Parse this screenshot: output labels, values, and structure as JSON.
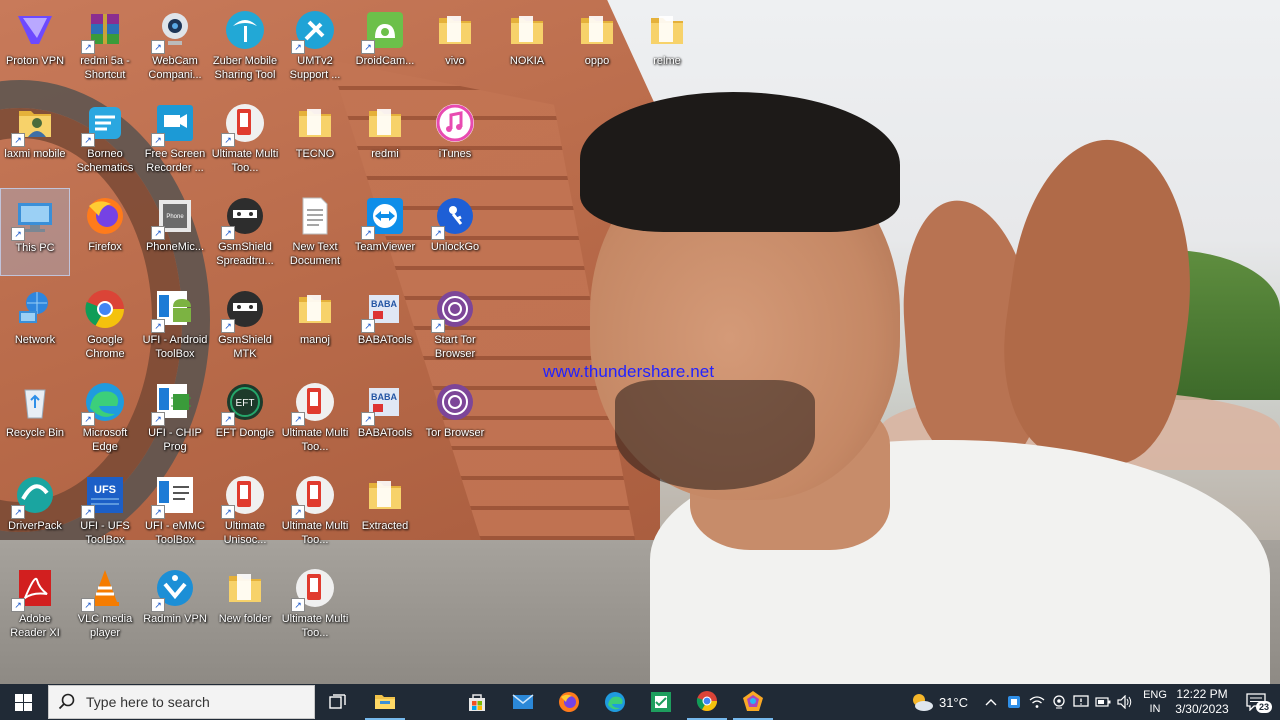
{
  "desktop": {
    "watermark": "www.thundershare.net",
    "icons": [
      {
        "label": "Proton VPN",
        "icon": "proton-vpn-icon"
      },
      {
        "label": "redmi 5a - Shortcut",
        "icon": "winrar-icon"
      },
      {
        "label": "WebCam Compani...",
        "icon": "webcam-icon"
      },
      {
        "label": "Zuber Mobile Sharing Tool",
        "icon": "palm-tree-icon"
      },
      {
        "label": "UMTv2 Support ...",
        "icon": "tools-icon"
      },
      {
        "label": "DroidCam...",
        "icon": "droidcam-icon"
      },
      {
        "label": "vivo",
        "icon": "folder-icon"
      },
      {
        "label": "NOKIA",
        "icon": "folder-icon"
      },
      {
        "label": "oppo",
        "icon": "folder-icon"
      },
      {
        "label": "relme",
        "icon": "folder-icon"
      },
      {
        "label": "laxmi mobile",
        "icon": "user-folder-icon"
      },
      {
        "label": "Borneo Schematics",
        "icon": "borneo-icon"
      },
      {
        "label": "Free Screen Recorder ...",
        "icon": "screen-recorder-icon"
      },
      {
        "label": "Ultimate Multi Too...",
        "icon": "ultimate-multi-tool-icon"
      },
      {
        "label": "TECNO",
        "icon": "folder-icon"
      },
      {
        "label": "redmi",
        "icon": "folder-icon"
      },
      {
        "label": "iTunes",
        "icon": "itunes-icon"
      },
      {
        "label": "This PC",
        "icon": "this-pc-icon"
      },
      {
        "label": "Firefox",
        "icon": "firefox-icon"
      },
      {
        "label": "PhoneMic...",
        "icon": "phonemic-icon"
      },
      {
        "label": "GsmShield Spreadtru...",
        "icon": "gsmshield-icon"
      },
      {
        "label": "New Text Document",
        "icon": "text-document-icon"
      },
      {
        "label": "TeamViewer",
        "icon": "teamviewer-icon"
      },
      {
        "label": "UnlockGo",
        "icon": "unlockgo-icon"
      },
      {
        "label": "Network",
        "icon": "network-icon"
      },
      {
        "label": "Google Chrome",
        "icon": "chrome-icon"
      },
      {
        "label": "UFI - Android ToolBox",
        "icon": "ufi-android-icon"
      },
      {
        "label": "GsmShield MTK",
        "icon": "gsmshield-icon"
      },
      {
        "label": "manoj",
        "icon": "folder-icon"
      },
      {
        "label": "BABATools",
        "icon": "babatools-icon"
      },
      {
        "label": "Start Tor Browser",
        "icon": "tor-icon"
      },
      {
        "label": "Recycle Bin",
        "icon": "recycle-bin-icon"
      },
      {
        "label": "Microsoft Edge",
        "icon": "edge-icon"
      },
      {
        "label": "UFI - CHIP Prog",
        "icon": "ufi-chip-icon"
      },
      {
        "label": "EFT Dongle",
        "icon": "eft-dongle-icon"
      },
      {
        "label": "Ultimate Multi Too...",
        "icon": "ultimate-multi-tool-icon"
      },
      {
        "label": "BABATools",
        "icon": "babatools-icon"
      },
      {
        "label": "Tor Browser",
        "icon": "tor-icon"
      },
      {
        "label": "DriverPack",
        "icon": "driverpack-icon"
      },
      {
        "label": "UFI - UFS ToolBox",
        "icon": "ufs-icon"
      },
      {
        "label": "UFI - eMMC ToolBox",
        "icon": "emmc-icon"
      },
      {
        "label": "Ultimate Unisoc...",
        "icon": "ultimate-multi-tool-icon"
      },
      {
        "label": "Ultimate Multi Too...",
        "icon": "ultimate-multi-tool-icon"
      },
      {
        "label": "Extracted",
        "icon": "folder-icon"
      },
      {
        "label": "Adobe Reader XI",
        "icon": "adobe-reader-icon"
      },
      {
        "label": "VLC media player",
        "icon": "vlc-icon"
      },
      {
        "label": "Radmin VPN",
        "icon": "radmin-vpn-icon"
      },
      {
        "label": "New folder",
        "icon": "folder-icon"
      },
      {
        "label": "Ultimate Multi Too...",
        "icon": "ultimate-multi-tool-icon"
      }
    ],
    "selected_icon": "This PC"
  },
  "taskbar": {
    "search_placeholder": "Type here to search",
    "pinned": [
      "task-view",
      "file-explorer",
      "microsoft-store",
      "mail",
      "firefox",
      "edge",
      "app-green",
      "chrome",
      "app-color"
    ],
    "weather": "31°C",
    "language": "ENG",
    "region": "IN",
    "time": "12:22 PM",
    "date": "3/30/2023",
    "notification_count": "23"
  },
  "colors": {
    "taskbar_bg": "#202a36",
    "watermark": "#2222ff",
    "folder": "#f0c445"
  }
}
